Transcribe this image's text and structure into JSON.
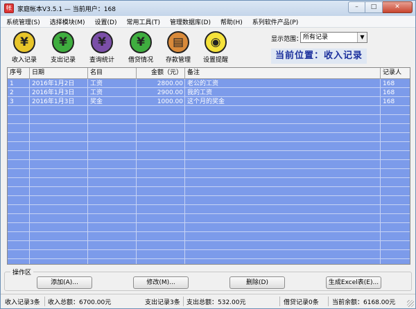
{
  "window": {
    "title": "家庭帐本V3.5.1  —  当前用户：168",
    "controls": {
      "minimize": "–",
      "maximize": "□",
      "close": "✕"
    }
  },
  "menu": [
    "系统管理(S)",
    "选择模块(M)",
    "设置(D)",
    "常用工具(T)",
    "管理数据库(D)",
    "帮助(H)",
    "系列软件产品(P)"
  ],
  "toolbar": [
    {
      "label": "收入记录",
      "icon": "yuan-coin-icon",
      "glyph": "¥",
      "color": "#e8c52a"
    },
    {
      "label": "支出记录",
      "icon": "yuan-coin-icon",
      "glyph": "¥",
      "color": "#3fae3f"
    },
    {
      "label": "查询统计",
      "icon": "search-icon",
      "glyph": "¥",
      "color": "#7b4fa8"
    },
    {
      "label": "借贷情况",
      "icon": "exchange-icon",
      "glyph": "¥",
      "color": "#3fae3f"
    },
    {
      "label": "存款管理",
      "icon": "bank-book-icon",
      "glyph": "▤",
      "color": "#d98a3a"
    },
    {
      "label": "设置提醒",
      "icon": "lightbulb-icon",
      "glyph": "◉",
      "color": "#f5e23a"
    }
  ],
  "range": {
    "label": "显示范围：",
    "selected": "所有记录",
    "arrow": "▼"
  },
  "location": "当前位置：收入记录",
  "table": {
    "columns": [
      "序号",
      "日期",
      "名目",
      "金额（元）",
      "备注",
      "记录人"
    ],
    "rows": [
      [
        "1",
        "2016年1月2日",
        "工资",
        "2800.00",
        "老公的工资",
        "168"
      ],
      [
        "2",
        "2016年1月3日",
        "工资",
        "2900.00",
        "我的工资",
        "168"
      ],
      [
        "3",
        "2016年1月3日",
        "奖金",
        "1000.00",
        "这个月的奖金",
        "168"
      ]
    ]
  },
  "operations": {
    "title": "操作区",
    "add": "添加(A)...",
    "edit": "修改(M)...",
    "delete": "删除(D)",
    "excel": "生成Excel表(E)..."
  },
  "status": {
    "income_count": "收入记录3条",
    "income_total": "收入总额：6700.00元",
    "expense_count": "支出记录3条",
    "expense_total": "支出总额：532.00元",
    "loan_count": "借贷记录0条",
    "balance": "当前余额：6168.00元"
  }
}
